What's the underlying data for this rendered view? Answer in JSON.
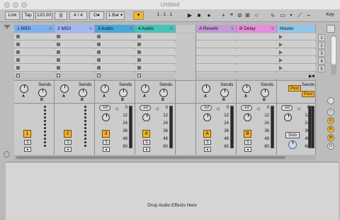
{
  "window": {
    "title": "Untitled"
  },
  "toolbar": {
    "link": "Link",
    "tap": "Tap",
    "tempo": "120.00",
    "sig_num": "4",
    "sig_sep": "/",
    "sig_den": "4",
    "metro_mode": "O●",
    "quantize": "1 Bar",
    "position": "1 .   1 .   1",
    "key": "Key"
  },
  "tracks": [
    {
      "name": "1 MIDI",
      "color": "#7fb0f0",
      "number": "1"
    },
    {
      "name": "2 MIDI",
      "color": "#a2b8f5",
      "number": "2"
    },
    {
      "name": "3 Audio",
      "color": "#4aa7d8",
      "number": "3"
    },
    {
      "name": "4 Audio",
      "color": "#45c5b8",
      "number": "4"
    },
    {
      "name": "A Reverb",
      "color": "#c699d8",
      "number": "A"
    },
    {
      "name": "B Delay",
      "color": "#e58ed9",
      "number": "B"
    },
    {
      "name": "Master",
      "color": "#8fc6ea"
    }
  ],
  "scenes": [
    "1",
    "2",
    "3",
    "4",
    "5"
  ],
  "sends": {
    "label": "Sends",
    "knob_a": "A",
    "knob_b": "B",
    "post": "Post"
  },
  "mixer": {
    "volume": "-Inf",
    "scale": [
      "0",
      "12",
      "24",
      "36",
      "48",
      "60"
    ],
    "solo_button": "S",
    "solo_label": "Solo"
  },
  "browser_panel": {
    "drop_hint": "Drop Audio Effects Here"
  },
  "status_buttons": [
    "I",
    "O",
    "R",
    "M",
    "D"
  ],
  "colors": {
    "accent": "#f5b52c",
    "background": "#b9b9b9"
  }
}
